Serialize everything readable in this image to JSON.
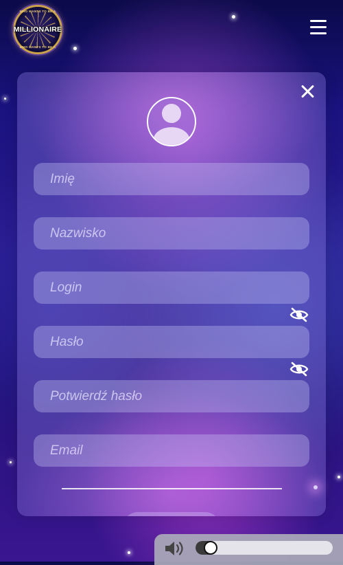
{
  "logo": {
    "word": "MILLIONAIRE",
    "ring_top": "WHO WANTS TO BE A",
    "ring_bottom": "WHO WANTS TO BE A"
  },
  "header": {
    "menu_icon": "hamburger-menu-icon"
  },
  "form": {
    "close_icon": "close-icon",
    "avatar_icon": "user-avatar-icon",
    "fields": {
      "first_name": {
        "placeholder": "Imię",
        "value": ""
      },
      "last_name": {
        "placeholder": "Nazwisko",
        "value": ""
      },
      "login": {
        "placeholder": "Login",
        "value": ""
      },
      "password": {
        "placeholder": "Hasło",
        "value": ""
      },
      "confirm_password": {
        "placeholder": "Potwierdź hasło",
        "value": ""
      },
      "email": {
        "placeholder": "Email",
        "value": ""
      }
    },
    "password_toggle_icon": "eye-slash-icon"
  },
  "audio": {
    "volume_icon": "speaker-volume-icon",
    "volume_level": 0.11
  },
  "colors": {
    "accent_white": "#ffffff",
    "audio_bar": "#aaaab9",
    "slider_fill": "#3a3a3a"
  }
}
